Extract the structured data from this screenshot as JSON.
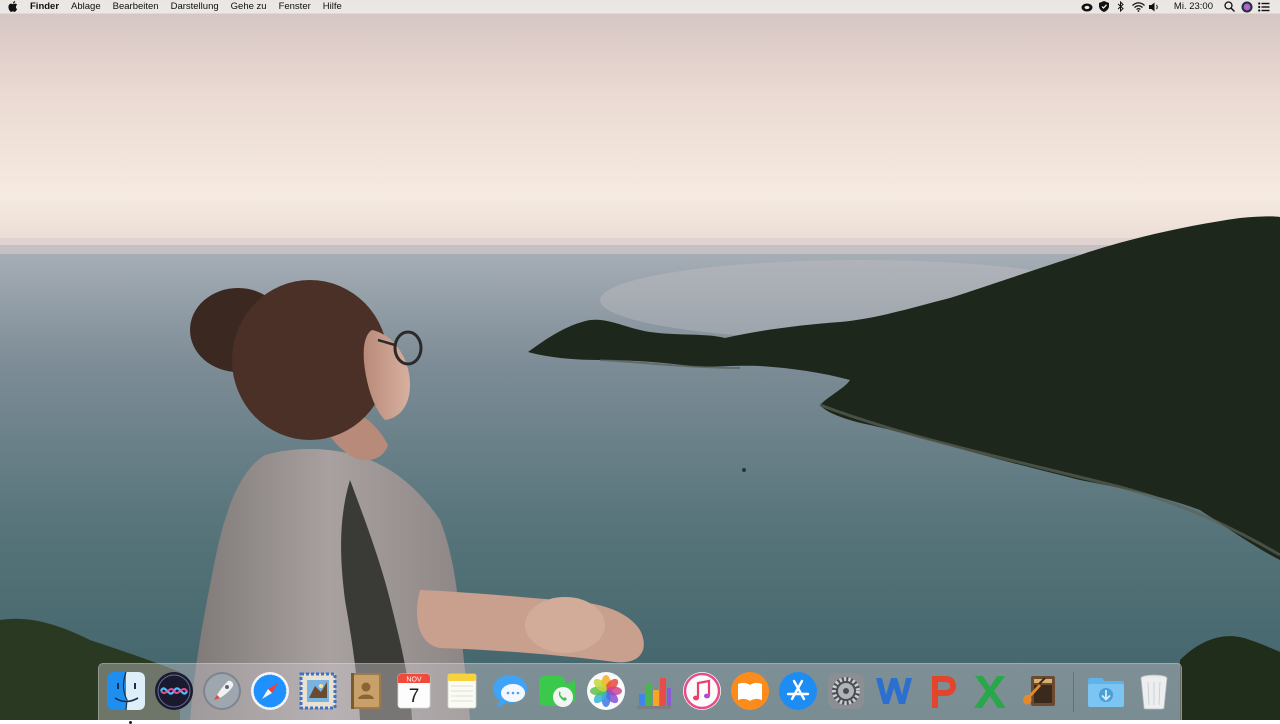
{
  "menubar": {
    "app_name": "Finder",
    "items": [
      "Ablage",
      "Bearbeiten",
      "Darstellung",
      "Gehe zu",
      "Fenster",
      "Hilfe"
    ],
    "clock": "Mi. 23:00",
    "status_icons": [
      "creative-cloud-icon",
      "shield-icon",
      "bluetooth-icon",
      "wifi-icon",
      "volume-icon",
      "spotlight-search-icon",
      "siri-icon",
      "notification-center-icon"
    ]
  },
  "dock": {
    "apps": [
      {
        "name": "Finder",
        "icon": "finder-icon",
        "running": true
      },
      {
        "name": "Siri",
        "icon": "siri-icon",
        "running": false
      },
      {
        "name": "Launchpad",
        "icon": "launchpad-icon",
        "running": false
      },
      {
        "name": "Safari",
        "icon": "safari-icon",
        "running": false
      },
      {
        "name": "Mail",
        "icon": "mail-icon",
        "running": false
      },
      {
        "name": "Kontakte",
        "icon": "contacts-icon",
        "running": false
      },
      {
        "name": "Kalender",
        "icon": "calendar-icon",
        "running": false
      },
      {
        "name": "Notizen",
        "icon": "notes-icon",
        "running": false
      },
      {
        "name": "Nachrichten",
        "icon": "messages-icon",
        "running": false
      },
      {
        "name": "FaceTime",
        "icon": "facetime-icon",
        "running": false
      },
      {
        "name": "Fotos",
        "icon": "photos-icon",
        "running": false
      },
      {
        "name": "Numbers",
        "icon": "numbers-icon",
        "running": false
      },
      {
        "name": "iTunes",
        "icon": "itunes-icon",
        "running": false
      },
      {
        "name": "iBooks",
        "icon": "ibooks-icon",
        "running": false
      },
      {
        "name": "App Store",
        "icon": "app-store-icon",
        "running": false
      },
      {
        "name": "Systemeinstellungen",
        "icon": "system-preferences-icon",
        "running": false
      },
      {
        "name": "Word",
        "icon": "word-icon",
        "running": false
      },
      {
        "name": "PowerPoint",
        "icon": "powerpoint-icon",
        "running": false
      },
      {
        "name": "Excel",
        "icon": "excel-icon",
        "running": false
      },
      {
        "name": "GarageBand",
        "icon": "garageband-icon",
        "running": false
      }
    ],
    "calendar_month": "NOV",
    "calendar_day": "7",
    "extras": [
      {
        "name": "Downloads",
        "icon": "downloads-folder-icon"
      },
      {
        "name": "Papierkorb",
        "icon": "trash-icon"
      }
    ]
  },
  "colors": {
    "sky_top": "#d9c9c4",
    "sky_horizon": "#f3e6dc",
    "sea": "#5d7a80",
    "dark_land": "#1f2a1e",
    "menubar_bg": "#ece9e7"
  }
}
